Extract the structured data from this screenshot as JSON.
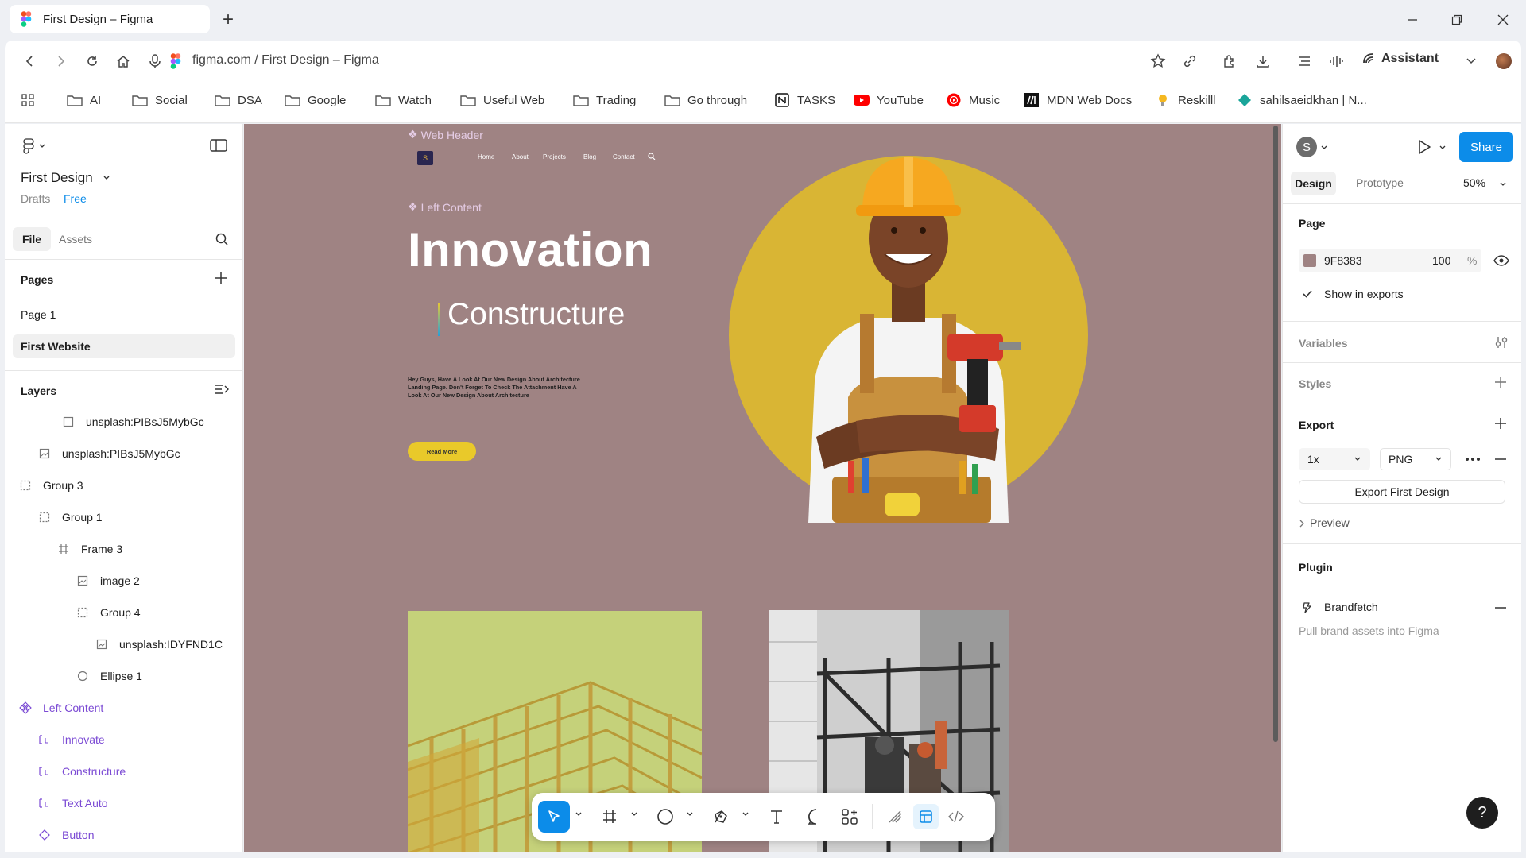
{
  "browser": {
    "tab_title": "First Design – Figma",
    "url": "figma.com / First Design – Figma",
    "assistant_label": "Assistant"
  },
  "bookmarks": [
    {
      "label": "AI",
      "icon": "folder-icon"
    },
    {
      "label": "Social",
      "icon": "folder-icon"
    },
    {
      "label": "DSA",
      "icon": "folder-icon"
    },
    {
      "label": "Google",
      "icon": "folder-icon"
    },
    {
      "label": "Watch",
      "icon": "folder-icon"
    },
    {
      "label": "Useful Web",
      "icon": "folder-icon"
    },
    {
      "label": "Trading",
      "icon": "folder-icon"
    },
    {
      "label": "Go through",
      "icon": "folder-icon"
    },
    {
      "label": "TASKS",
      "icon": "notion-icon"
    },
    {
      "label": "YouTube",
      "icon": "youtube-icon"
    },
    {
      "label": "Music",
      "icon": "youtube-music-icon"
    },
    {
      "label": "MDN Web Docs",
      "icon": "mdn-icon"
    },
    {
      "label": "Reskilll",
      "icon": "bulb-icon"
    },
    {
      "label": "sahilsaeidkhan | N...",
      "icon": "diamond-icon"
    }
  ],
  "left_panel": {
    "file_title": "First Design",
    "location": "Drafts",
    "plan_badge": "Free",
    "tabs": {
      "file": "File",
      "assets": "Assets"
    },
    "pages_heading": "Pages",
    "pages": [
      {
        "label": "Page 1",
        "selected": false
      },
      {
        "label": "First Website",
        "selected": true
      }
    ],
    "layers_heading": "Layers",
    "layers": [
      {
        "label": "unsplash:PIBsJ5MybGc",
        "icon": "rectangle-icon"
      },
      {
        "label": "unsplash:PIBsJ5MybGc",
        "icon": "image-icon"
      },
      {
        "label": "Group 3",
        "icon": "group-icon"
      },
      {
        "label": "Group 1",
        "icon": "group-icon"
      },
      {
        "label": "Frame 3",
        "icon": "frame-icon"
      },
      {
        "label": "image 2",
        "icon": "image-icon"
      },
      {
        "label": "Group 4",
        "icon": "group-icon"
      },
      {
        "label": "unsplash:IDYFND1C",
        "icon": "image-icon"
      },
      {
        "label": "Ellipse 1",
        "icon": "ellipse-icon"
      },
      {
        "label": "Left Content",
        "icon": "component-icon"
      },
      {
        "label": "Innovate",
        "icon": "text-instance-icon"
      },
      {
        "label": "Constructure",
        "icon": "text-instance-icon"
      },
      {
        "label": "Text Auto",
        "icon": "text-instance-icon"
      },
      {
        "label": "Button",
        "icon": "instance-icon"
      }
    ]
  },
  "canvas": {
    "background": "#9F8383",
    "web_header_label": "Web Header",
    "left_content_label": "Left Content",
    "site_logo": "S",
    "nav": [
      "Home",
      "About",
      "Projects",
      "Blog",
      "Contact"
    ],
    "hero_title": "Innovation",
    "hero_subtitle": "Constructure",
    "hero_paragraph": "Hey Guys, Have A Look At Our New Design About Architecture Landing Page. Don't Forget To Check The Attachment Have A Look At Our New Design About Architecture",
    "cta_label": "Read More",
    "circle_color": "#D9B534",
    "button_color": "#E9C92A"
  },
  "right_panel": {
    "avatar_initial": "S",
    "share_label": "Share",
    "tabs": {
      "design": "Design",
      "prototype": "Prototype"
    },
    "zoom": "50%",
    "page_heading": "Page",
    "page_color_hex": "9F8383",
    "page_opacity": "100",
    "percent_sign": "%",
    "show_in_exports": "Show in exports",
    "show_in_exports_checked": true,
    "variables_heading": "Variables",
    "styles_heading": "Styles",
    "export_heading": "Export",
    "export_scale": "1x",
    "export_format": "PNG",
    "export_button": "Export First Design",
    "preview_label": "Preview",
    "plugin_heading": "Plugin",
    "plugin_name": "Brandfetch",
    "plugin_desc": "Pull brand assets into Figma"
  },
  "help_label": "?",
  "accent_color": "#0C8CE9"
}
